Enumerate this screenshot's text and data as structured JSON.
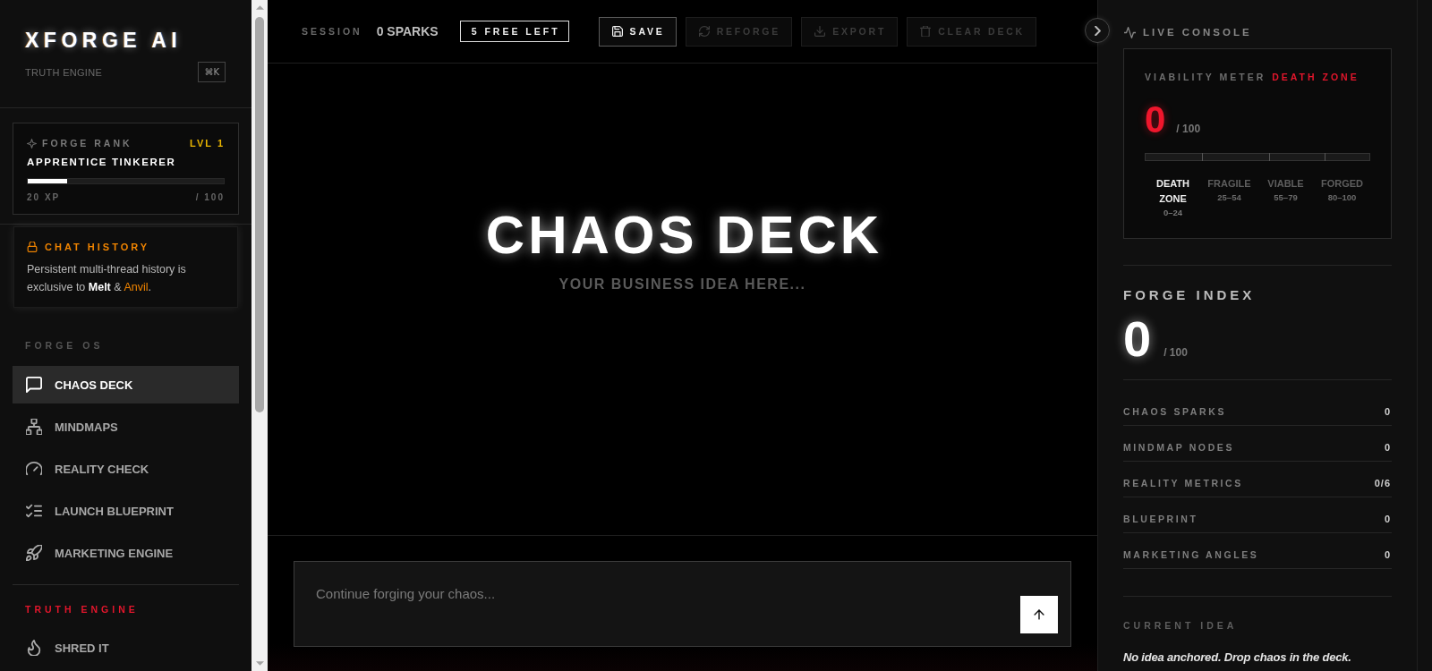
{
  "sidebar": {
    "brand": {
      "title": "XFORGE AI",
      "subtitle": "TRUTH ENGINE",
      "shortcut": "⌘K"
    },
    "rank_card": {
      "label": "FORGE RANK",
      "level_label": "LVL 1",
      "rank": "APPRENTICE TINKERER",
      "xp": {
        "level": 0.2,
        "reading": "20 XP",
        "max": "/ 100"
      }
    },
    "locked_card": {
      "title": "CHAT HISTORY",
      "body": [
        {
          "text": "Persistent multi-thread history is exclusive to ",
          "kind": "plain"
        },
        {
          "text": "Melt",
          "kind": "strong"
        },
        {
          "text": " & ",
          "kind": "plain"
        },
        {
          "text": "Anvil",
          "kind": "accent"
        },
        {
          "text": ".",
          "kind": "plain"
        }
      ]
    },
    "sections": [
      {
        "heading": "FORGE OS",
        "kind": "muted",
        "items": [
          {
            "label": "CHAOS DECK",
            "selected": true
          },
          {
            "label": "MINDMAPS",
            "selected": false
          },
          {
            "label": "REALITY CHECK",
            "selected": false
          },
          {
            "label": "LAUNCH BLUEPRINT",
            "selected": false
          },
          {
            "label": "MARKETING ENGINE",
            "selected": false
          }
        ]
      },
      {
        "heading": "TRUTH ENGINE",
        "kind": "alert",
        "items": [
          {
            "label": "SHRED IT",
            "selected": false
          }
        ]
      }
    ]
  },
  "toolbar": {
    "session_label": "SESSION",
    "sparks": "0 SPARKS",
    "free_badge": "5 FREE LEFT",
    "actions": [
      {
        "label": "SAVE",
        "disabled": false
      },
      {
        "label": "REFORGE",
        "disabled": true
      },
      {
        "label": "EXPORT",
        "disabled": true
      },
      {
        "label": "CLEAR DECK",
        "disabled": true
      }
    ]
  },
  "hero": {
    "title": "CHAOS DECK",
    "subtitle": "YOUR BUSINESS IDEA HERE..."
  },
  "composer": {
    "placeholder": "Continue forging your chaos..."
  },
  "console": {
    "title": "LIVE CONSOLE",
    "viability": {
      "label": "VIABILITY METER",
      "status": "DEATH ZONE",
      "score": "0",
      "max": "/ 100",
      "zones": [
        {
          "name": "DEATH ZONE",
          "range": "0–24",
          "selected": true
        },
        {
          "name": "FRAGILE",
          "range": "25–54",
          "selected": false
        },
        {
          "name": "VIABLE",
          "range": "55–79",
          "selected": false
        },
        {
          "name": "FORGED",
          "range": "80–100",
          "selected": false
        }
      ]
    },
    "forge_index": {
      "title": "FORGE INDEX",
      "score": "0",
      "max": "/ 100"
    },
    "stats": [
      {
        "label": "CHAOS SPARKS",
        "value": "0"
      },
      {
        "label": "MINDMAP NODES",
        "value": "0"
      },
      {
        "label": "REALITY METRICS",
        "value": "0/6"
      },
      {
        "label": "BLUEPRINT",
        "value": "0"
      },
      {
        "label": "MARKETING ANGLES",
        "value": "0"
      }
    ],
    "current_idea": {
      "label": "CURRENT IDEA",
      "text": "No idea anchored. Drop chaos in the deck."
    }
  }
}
